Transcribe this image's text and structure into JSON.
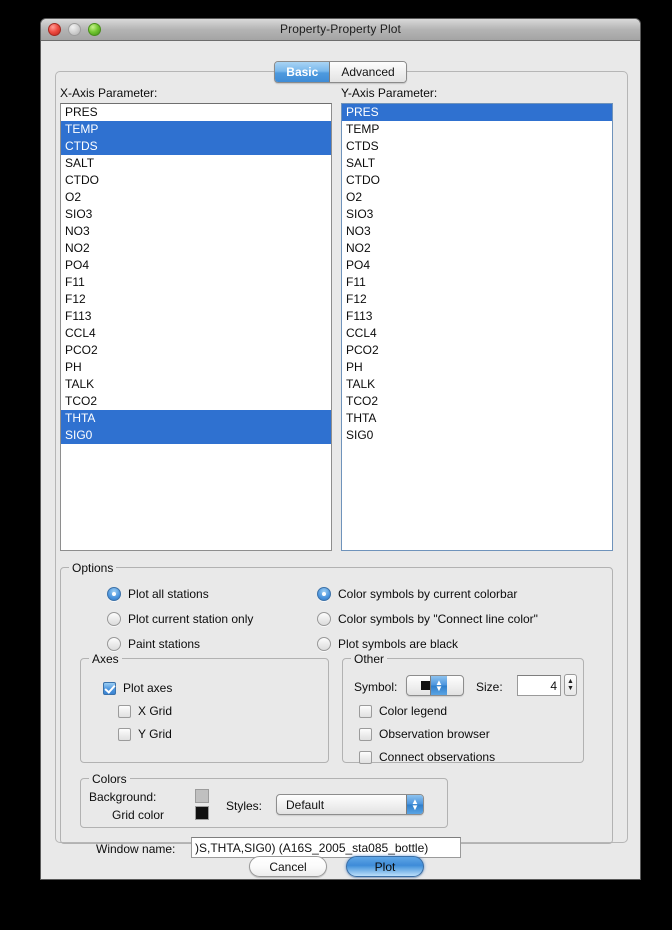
{
  "window": {
    "title": "Property-Property Plot",
    "traffic_lights": [
      "close-button",
      "minimize-button",
      "zoom-button"
    ]
  },
  "tabs": [
    {
      "label": "Basic",
      "selected": true
    },
    {
      "label": "Advanced",
      "selected": false
    }
  ],
  "x_axis": {
    "label": "X-Axis Parameter:",
    "items": [
      {
        "label": "PRES",
        "selected": false
      },
      {
        "label": "TEMP",
        "selected": true
      },
      {
        "label": "CTDS",
        "selected": true
      },
      {
        "label": "SALT",
        "selected": false
      },
      {
        "label": "CTDO",
        "selected": false
      },
      {
        "label": "O2",
        "selected": false
      },
      {
        "label": "SIO3",
        "selected": false
      },
      {
        "label": "NO3",
        "selected": false
      },
      {
        "label": "NO2",
        "selected": false
      },
      {
        "label": "PO4",
        "selected": false
      },
      {
        "label": "F11",
        "selected": false
      },
      {
        "label": "F12",
        "selected": false
      },
      {
        "label": "F113",
        "selected": false
      },
      {
        "label": "CCL4",
        "selected": false
      },
      {
        "label": "PCO2",
        "selected": false
      },
      {
        "label": "PH",
        "selected": false
      },
      {
        "label": "TALK",
        "selected": false
      },
      {
        "label": "TCO2",
        "selected": false
      },
      {
        "label": "THTA",
        "selected": true
      },
      {
        "label": "SIG0",
        "selected": true
      }
    ]
  },
  "y_axis": {
    "label": "Y-Axis Parameter:",
    "items": [
      {
        "label": "PRES",
        "selected": true
      },
      {
        "label": "TEMP",
        "selected": false
      },
      {
        "label": "CTDS",
        "selected": false
      },
      {
        "label": "SALT",
        "selected": false
      },
      {
        "label": "CTDO",
        "selected": false
      },
      {
        "label": "O2",
        "selected": false
      },
      {
        "label": "SIO3",
        "selected": false
      },
      {
        "label": "NO3",
        "selected": false
      },
      {
        "label": "NO2",
        "selected": false
      },
      {
        "label": "PO4",
        "selected": false
      },
      {
        "label": "F11",
        "selected": false
      },
      {
        "label": "F12",
        "selected": false
      },
      {
        "label": "F113",
        "selected": false
      },
      {
        "label": "CCL4",
        "selected": false
      },
      {
        "label": "PCO2",
        "selected": false
      },
      {
        "label": "PH",
        "selected": false
      },
      {
        "label": "TALK",
        "selected": false
      },
      {
        "label": "TCO2",
        "selected": false
      },
      {
        "label": "THTA",
        "selected": false
      },
      {
        "label": "SIG0",
        "selected": false
      }
    ]
  },
  "options": {
    "legend": "Options",
    "station_radios": [
      {
        "label": "Plot all stations",
        "selected": true
      },
      {
        "label": "Plot current station only",
        "selected": false
      },
      {
        "label": "Paint stations",
        "selected": false
      }
    ],
    "color_radios": [
      {
        "label": "Color symbols by current colorbar",
        "selected": true
      },
      {
        "label": "Color symbols by \"Connect line color\"",
        "selected": false
      },
      {
        "label": "Plot symbols are black",
        "selected": false
      }
    ]
  },
  "axes": {
    "legend": "Axes",
    "checks": [
      {
        "label": "Plot axes",
        "checked": true
      },
      {
        "label": "X Grid",
        "checked": false
      },
      {
        "label": "Y Grid",
        "checked": false
      }
    ]
  },
  "other": {
    "legend": "Other",
    "symbol_label": "Symbol:",
    "symbol_value": "square-symbol",
    "size_label": "Size:",
    "size_value": "4",
    "checks": [
      {
        "label": "Color legend",
        "checked": false
      },
      {
        "label": "Observation browser",
        "checked": false
      },
      {
        "label": "Connect observations",
        "checked": false
      }
    ]
  },
  "colors": {
    "legend": "Colors",
    "background_label": "Background:",
    "background_color": "#c0c0c0",
    "grid_label": "Grid color",
    "grid_color": "#101010",
    "styles_label": "Styles:",
    "styles_value": "Default"
  },
  "window_name": {
    "label": "Window name:",
    "value": ")S,THTA,SIG0) (A16S_2005_sta085_bottle)"
  },
  "buttons": {
    "cancel": "Cancel",
    "plot": "Plot"
  },
  "accent": "#2f71d0"
}
